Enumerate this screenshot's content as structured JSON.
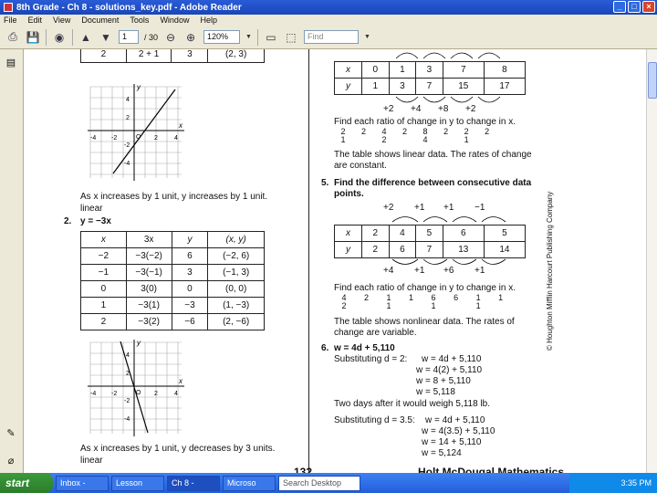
{
  "window": {
    "title": "8th Grade - Ch 8 - solutions_key.pdf - Adobe Reader"
  },
  "menu": [
    "File",
    "Edit",
    "View",
    "Document",
    "Tools",
    "Window",
    "Help"
  ],
  "toolbar": {
    "page_value": "1",
    "page_total": "/ 30",
    "zoom": "120%",
    "find_placeholder": "Find"
  },
  "left": {
    "row2": [
      "2",
      "2 + 1",
      "3",
      "(2, 3)"
    ],
    "graph_labels": [
      "y",
      "x",
      "4",
      "2",
      "-4",
      "-2",
      "2",
      "4",
      "O",
      "-2",
      "-4"
    ],
    "text1_line1": "As x increases by 1 unit, y increases by 1 unit.",
    "text1_line2": "linear",
    "ex2_num": "2.",
    "ex2_eq": "y = −3x",
    "table2_headers": [
      "x",
      "3x",
      "y",
      "(x, y)"
    ],
    "table2_rows": [
      [
        "−2",
        "−3(−2)",
        "6",
        "(−2, 6)"
      ],
      [
        "−1",
        "−3(−1)",
        "3",
        "(−1, 3)"
      ],
      [
        "0",
        "3(0)",
        "0",
        "(0, 0)"
      ],
      [
        "1",
        "−3(1)",
        "−3",
        "(1, −3)"
      ],
      [
        "2",
        "−3(2)",
        "−6",
        "(2, −6)"
      ]
    ],
    "text2_line1": "As x increases by 1 unit, y decreases by 3 units.",
    "text2_line2": "linear"
  },
  "right": {
    "t1_x": [
      "x",
      "0",
      "1",
      "3",
      "7",
      "8"
    ],
    "t1_y": [
      "y",
      "1",
      "3",
      "7",
      "15",
      "17"
    ],
    "t1_diffs": [
      "+2",
      "+4",
      "+8",
      "+2"
    ],
    "ratio_head": "Find each ratio of change in y to change in x.",
    "ratios1": [
      "2",
      "1",
      "2",
      "4",
      "2",
      "2",
      "8",
      "4",
      "2",
      "2",
      "1",
      "2"
    ],
    "conclusion1": "The table shows linear data. The rates of change",
    "conclusion1b": "are constant.",
    "q5_num": "5.",
    "q5_text": "Find the difference between consecutive data",
    "q5_text2": "points.",
    "t2_xdiffs": [
      "+2",
      "+1",
      "+1",
      "−1"
    ],
    "t2_x": [
      "x",
      "2",
      "4",
      "5",
      "6",
      "5"
    ],
    "t2_y": [
      "y",
      "2",
      "6",
      "7",
      "13",
      "14"
    ],
    "t2_ydiffs": [
      "+4",
      "+1",
      "+6",
      "+1"
    ],
    "ratio_head2": "Find each ratio of change in y to change in x.",
    "ratios2": [
      "4",
      "2",
      "2",
      "1",
      "1",
      "1",
      "6",
      "1",
      "6",
      "1",
      "1",
      "1"
    ],
    "conclusion2": "The table shows nonlinear data. The rates of",
    "conclusion2b": "change are variable.",
    "q6_num": "6.",
    "q6_eq": "w = 4d + 5,110",
    "q6_sub": "Substituting d = 2:",
    "q6_lines": [
      "w = 4d + 5,110",
      "w = 4(2) + 5,110",
      "w = 8 + 5,110",
      "w = 5,118"
    ],
    "q6_two": "Two days after it would weigh 5,118 lb.",
    "q6_sub2": "Substituting d = 3.5:",
    "q6_lines2": [
      "w = 4d + 5,110",
      "w = 4(3.5) + 5,110",
      "w = 14 + 5,110",
      "w = 5,124"
    ],
    "footer_page": "132",
    "footer_book": "Holt McDougal Mathematics",
    "copyright": "© Houghton Mifflin Harcourt Publishing Company"
  },
  "taskbar": {
    "start": "start",
    "tasks": [
      "Inbox -",
      "Lesson",
      "Ch 8 -",
      "Microso",
      "Search Desktop"
    ],
    "clock": "3:35 PM"
  }
}
